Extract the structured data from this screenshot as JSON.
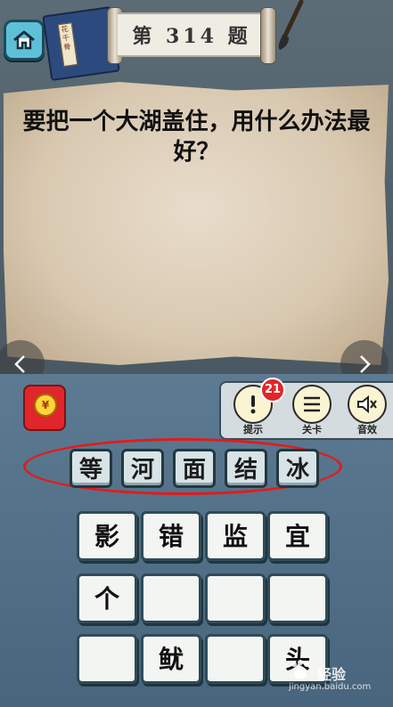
{
  "header": {
    "level_title": "第 314 题",
    "book_label": "花千骨"
  },
  "question": {
    "text": "要把一个大湖盖住，用什么办法最好？"
  },
  "tools": {
    "hint_label": "提示",
    "hint_count": "21",
    "levels_label": "关卡",
    "sound_label": "音效",
    "red_packet_symbol": "¥"
  },
  "answer": {
    "chars": [
      "等",
      "河",
      "面",
      "结",
      "冰"
    ],
    "highlight_color": "#e31b1b"
  },
  "candidates": {
    "rows": [
      [
        "影",
        "错",
        "监",
        "宜"
      ],
      [
        "个",
        "",
        "",
        ""
      ],
      [
        "",
        "鱿",
        "",
        "头"
      ]
    ]
  },
  "watermark": {
    "brand": "经验",
    "url": "jingyan.baidu.com"
  }
}
